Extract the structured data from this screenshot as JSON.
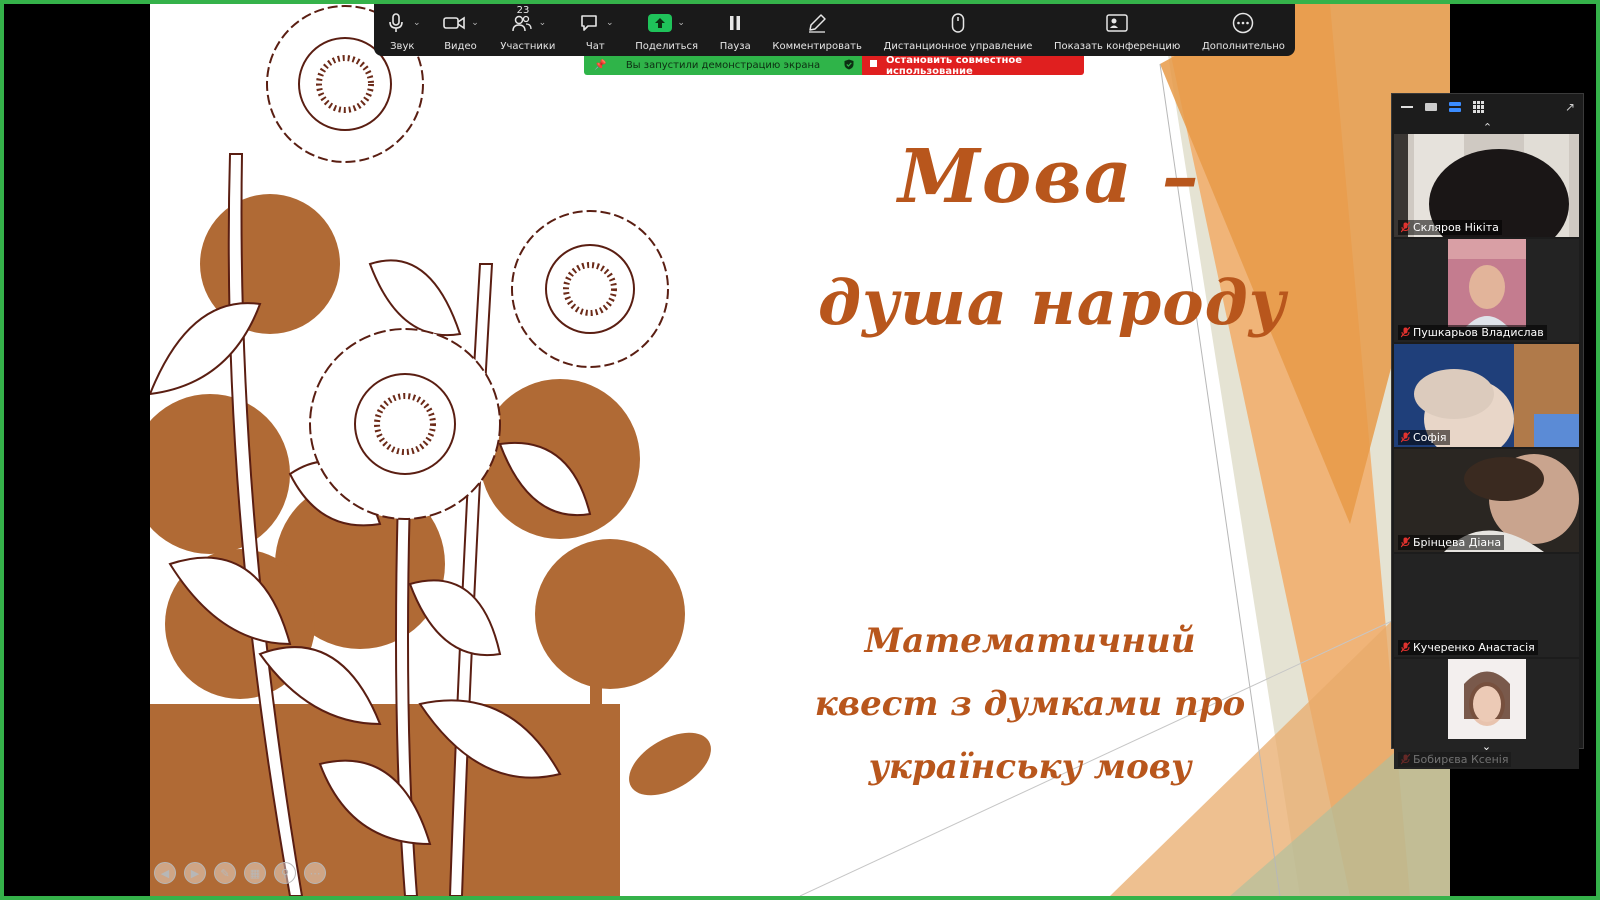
{
  "toolbar": {
    "audio_label": "Звук",
    "video_label": "Видео",
    "participants_label": "Участники",
    "participants_count": "23",
    "chat_label": "Чат",
    "share_label": "Поделиться",
    "pause_label": "Пауза",
    "annotate_label": "Комментировать",
    "remote_control_label": "Дистанционное управление",
    "show_meeting_label": "Показать конференцию",
    "more_label": "Дополнительно"
  },
  "share_status": {
    "sharing_text": "Вы запустили демонстрацию экрана",
    "stop_text": "Остановить совместное использование"
  },
  "slide": {
    "title_line1": "Мова –",
    "title_line2": "душа народу",
    "subtitle": "Математичний квест з думками про українську мову"
  },
  "participants": [
    {
      "name": "Скляров Нікіта",
      "muted": true
    },
    {
      "name": "Пушкарьов Владислав",
      "muted": true
    },
    {
      "name": "Софія",
      "muted": true
    },
    {
      "name": "Брінцева Діана",
      "muted": true
    },
    {
      "name": "Кучеренко Анастасія",
      "muted": true
    },
    {
      "name": "Бобирєва Ксенія",
      "muted": true
    }
  ],
  "colors": {
    "accent_orange": "#b8561c",
    "share_green": "#2fb449",
    "stop_red": "#e01f1f",
    "toolbar_bg": "#1a1a1a"
  }
}
